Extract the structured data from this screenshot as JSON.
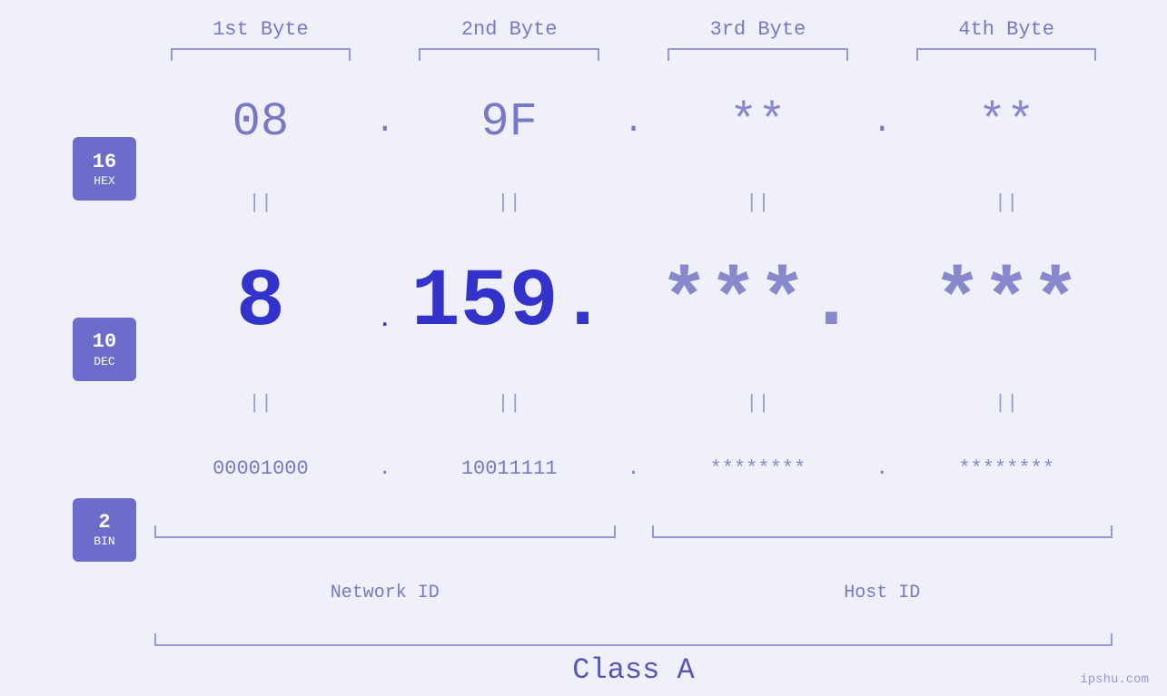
{
  "page": {
    "background": "#f0f0fb",
    "watermark": "ipshu.com"
  },
  "headers": {
    "byte1": "1st Byte",
    "byte2": "2nd Byte",
    "byte3": "3rd Byte",
    "byte4": "4th Byte"
  },
  "badges": {
    "hex": {
      "num": "16",
      "label": "HEX"
    },
    "dec": {
      "num": "10",
      "label": "DEC"
    },
    "bin": {
      "num": "2",
      "label": "BIN"
    }
  },
  "rows": {
    "hex": {
      "b1": "08",
      "b2": "9F",
      "b3": "**",
      "b4": "**",
      "dot": "."
    },
    "dec": {
      "b1": "8",
      "b2": "159.",
      "b3": "***.",
      "b4": "***",
      "dot": "."
    },
    "bin": {
      "b1": "00001000",
      "b2": "10011111",
      "b3": "********",
      "b4": "********",
      "dot": "."
    }
  },
  "equals": "||",
  "labels": {
    "network_id": "Network ID",
    "host_id": "Host ID",
    "class": "Class A"
  }
}
